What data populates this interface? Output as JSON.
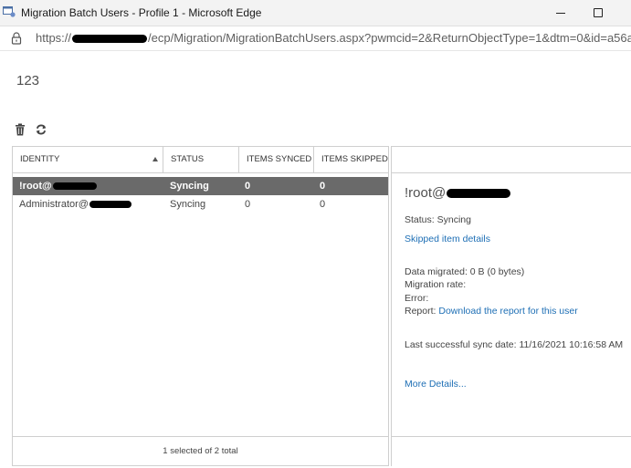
{
  "window": {
    "title": "Migration Batch Users - Profile 1 - Microsoft Edge"
  },
  "address": {
    "scheme": "https://",
    "path": "/ecp/Migration/MigrationBatchUsers.aspx?pwmcid=2&ReturnObjectType=1&dtm=0&id=a56a..."
  },
  "page": {
    "heading": "123"
  },
  "toolbar": {
    "icons": [
      "delete-icon",
      "refresh-icon"
    ]
  },
  "table": {
    "columns": [
      "IDENTITY",
      "STATUS",
      "ITEMS SYNCED",
      "ITEMS SKIPPED"
    ],
    "rows": [
      {
        "identity": "!root@",
        "status": "Syncing",
        "items_synced": "0",
        "items_skipped": "0",
        "selected": true
      },
      {
        "identity": "Administrator@",
        "status": "Syncing",
        "items_synced": "0",
        "items_skipped": "0",
        "selected": false
      }
    ],
    "footer": "1 selected of 2 total"
  },
  "details": {
    "title": "!root@",
    "status_line": "Status: Syncing",
    "skipped_link": "Skipped item details",
    "data_migrated": "Data migrated: 0 B (0 bytes)",
    "migration_rate": "Migration rate:",
    "error": "Error:",
    "report_label": "Report:",
    "report_link": "Download the report for this user",
    "last_sync": "Last successful sync date: 11/16/2021 10:16:58 AM",
    "more_details": "More Details..."
  },
  "colors": {
    "selected_row": "#6a6a6a",
    "link": "#1e6fb5",
    "border": "#cfcfcf"
  }
}
